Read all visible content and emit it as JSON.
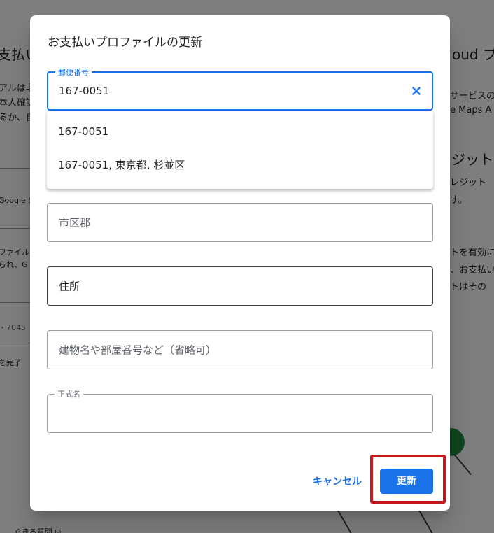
{
  "background": {
    "left_title": "支払い",
    "left_body_1": "アルは非",
    "left_body_2": "本人確認",
    "left_body_3": "るか、自",
    "left_google_store": "Google Sto",
    "left_profile_1": "ファイルは",
    "left_profile_2": "られ、G",
    "left_number": "・7045",
    "left_complete": "を完了",
    "right_title": "oud プ",
    "right_body_1": "サービスの",
    "right_body_2": "e Maps A",
    "right_credit_title": "ジット",
    "right_credit_1": "レジット",
    "right_credit_2": "す。",
    "right_enable_1": "トを有効に",
    "right_enable_2": "、お支払い",
    "right_enable_3": "トはその",
    "bottom_text": "ぐきる質問 ⊡"
  },
  "dialog": {
    "title": "お支払いプロファイルの更新",
    "postal_field": {
      "label": "郵便番号",
      "value": "167-0051"
    },
    "suggestions": [
      "167-0051",
      "167-0051, 東京都, 杉並区"
    ],
    "city_field": {
      "placeholder": "市区郡"
    },
    "address_field": {
      "placeholder": "住所"
    },
    "building_field": {
      "placeholder": "建物名や部屋番号など（省略可）"
    },
    "legal_name_field": {
      "label": "正式名",
      "value": ""
    },
    "cancel_label": "キャンセル",
    "update_label": "更新"
  },
  "colors": {
    "accent": "#1a73e8",
    "highlight": "#c5161d",
    "scrim": "rgba(0,0,0,0.50)"
  },
  "icons": {
    "clear": "close-icon"
  }
}
